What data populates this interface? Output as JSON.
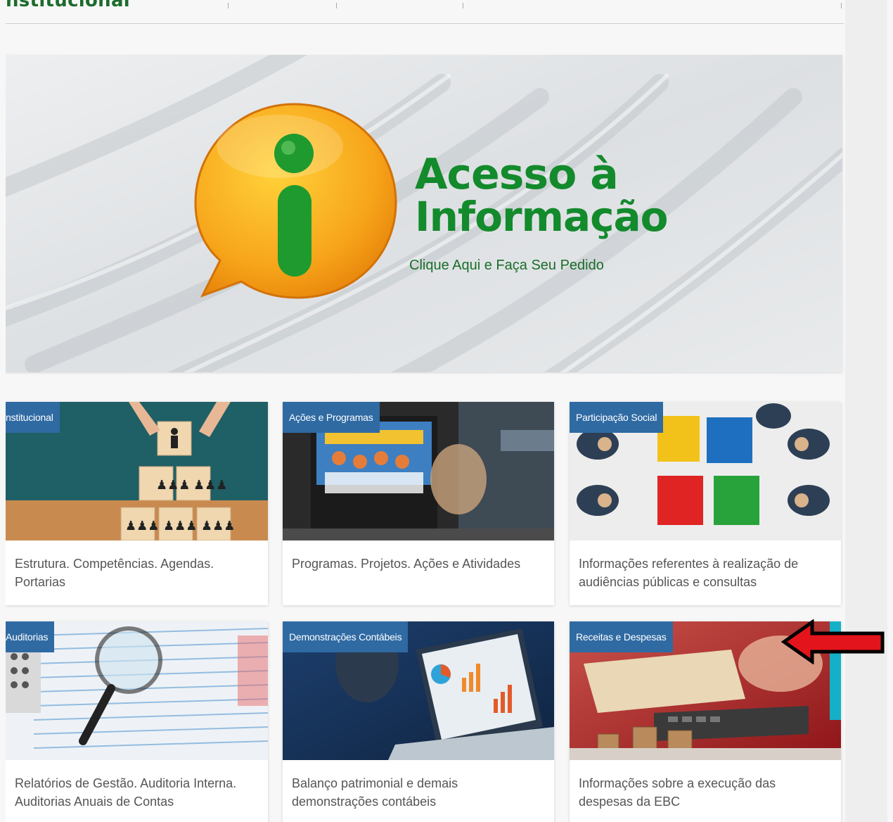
{
  "header": {
    "title": "nstitucional"
  },
  "banner": {
    "title_line1": "Acesso à",
    "title_line2": "Informação",
    "subtitle": "Clique Aqui e Faça Seu Pedido"
  },
  "cards": [
    {
      "tag": "nstitucional",
      "description": "Estrutura. Competências. Agendas. Portarias"
    },
    {
      "tag": "Ações e Programas",
      "description": "Programas. Projetos. Ações e Atividades"
    },
    {
      "tag": "Participação Social",
      "description": "Informações referentes à realização de audiências públicas e consultas"
    },
    {
      "tag": "Auditorias",
      "description": "Relatórios de Gestão. Auditoria Interna. Auditorias Anuais de Contas"
    },
    {
      "tag": "Demonstrações Contábeis",
      "description": "Balanço patrimonial e demais demonstrações contábeis"
    },
    {
      "tag": "Receitas e Despesas",
      "description": "Informações sobre a execução das despesas da EBC"
    }
  ],
  "colors": {
    "brand_green": "#138a2c",
    "tag_blue": "#2f6aa3",
    "annotation_red": "#e3141b"
  },
  "annotation": {
    "icon": "red-arrow-icon",
    "points_to": "Receitas e Despesas"
  }
}
